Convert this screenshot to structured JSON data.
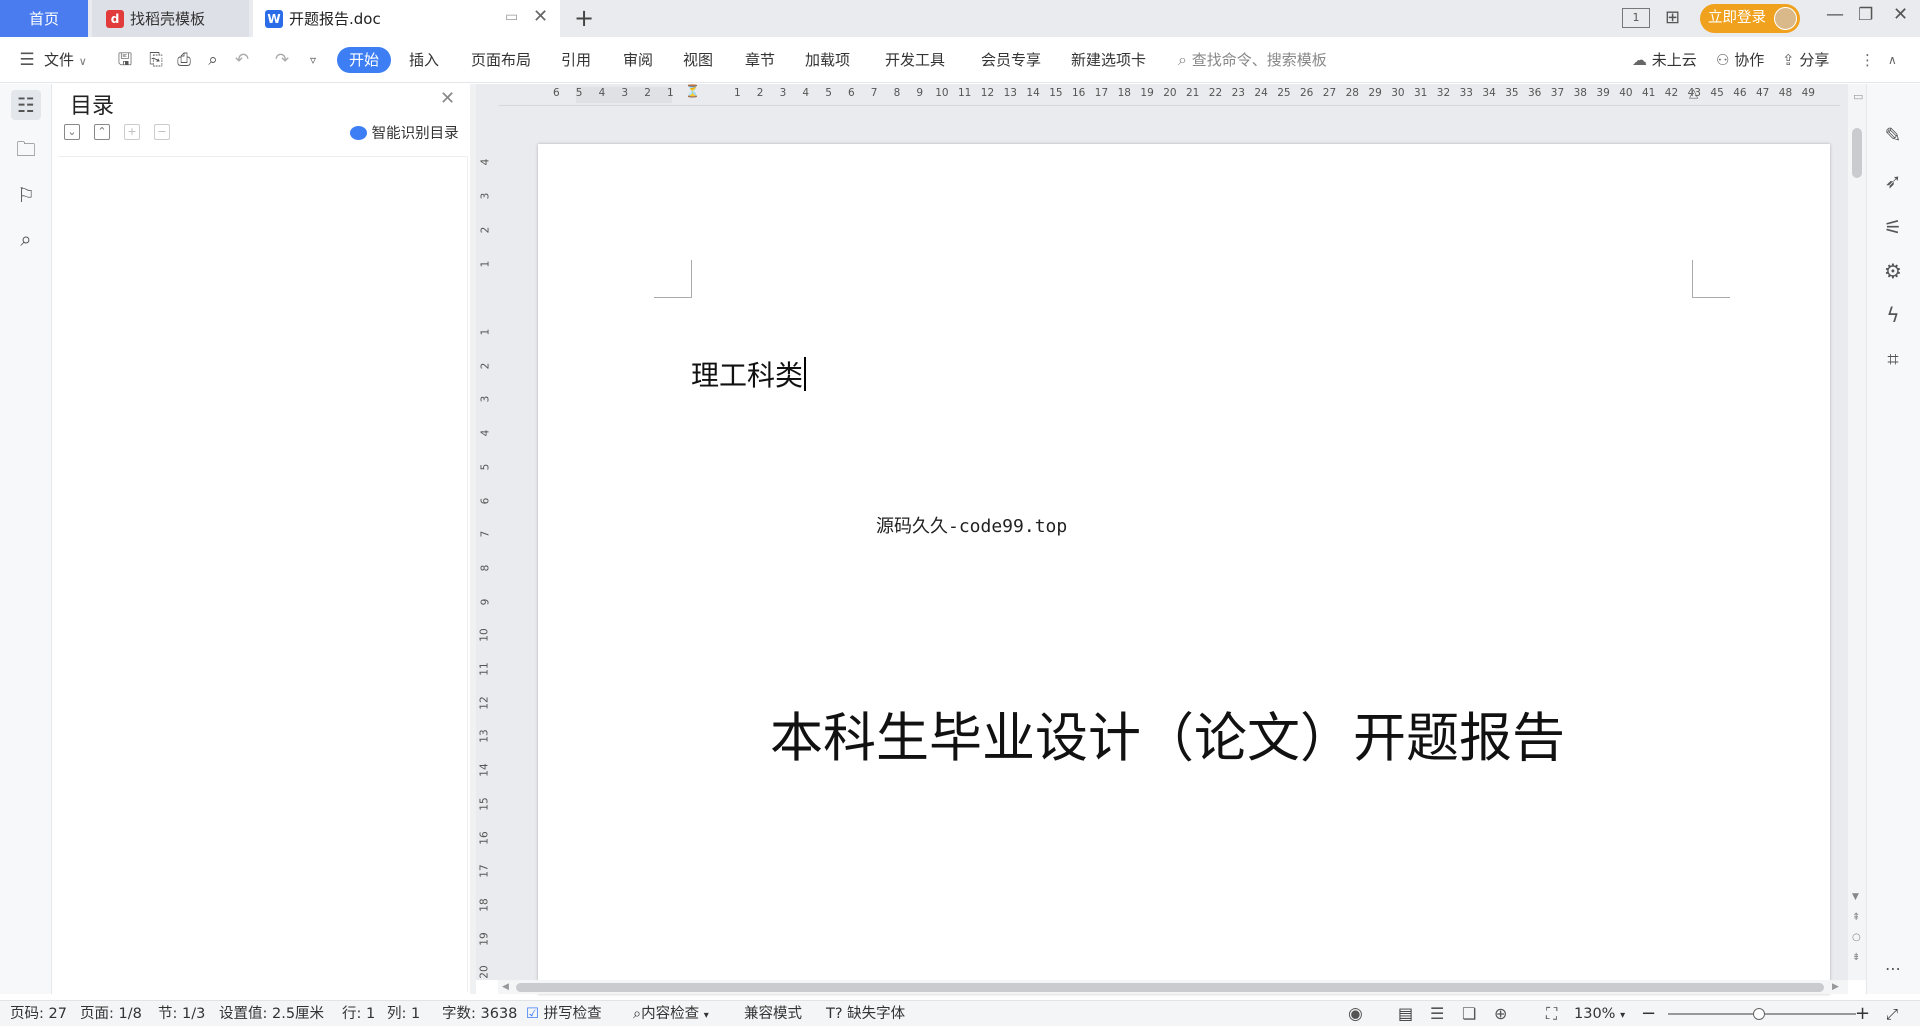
{
  "tabs": {
    "home": "首页",
    "daoke": "找稻壳模板",
    "doc": "开题报告.doc"
  },
  "topright": {
    "login": "立即登录"
  },
  "toolbar": {
    "file": "文件",
    "menus": [
      "开始",
      "插入",
      "页面布局",
      "引用",
      "审阅",
      "视图",
      "章节",
      "加载项",
      "开发工具",
      "会员专享",
      "新建选项卡"
    ],
    "search_placeholder": "查找命令、搜索模板",
    "cloud": "未上云",
    "collab": "协作",
    "share": "分享"
  },
  "toc": {
    "title": "目录",
    "smart": "智能识别目录"
  },
  "ruler": {
    "h_left": [
      "6",
      "5",
      "4",
      "3",
      "2",
      "1"
    ],
    "h_right": [
      "1",
      "2",
      "3",
      "4",
      "5",
      "6",
      "7",
      "8",
      "9",
      "10",
      "11",
      "12",
      "13",
      "14",
      "15",
      "16",
      "17",
      "18",
      "19",
      "20",
      "21",
      "22",
      "23",
      "24",
      "25",
      "26",
      "27",
      "28",
      "29",
      "30",
      "31",
      "32",
      "33",
      "34",
      "35",
      "36",
      "37",
      "38",
      "39",
      "40",
      "41",
      "42",
      "43",
      "45",
      "46",
      "47",
      "48",
      "49"
    ],
    "v_top": [
      "4",
      "3",
      "2",
      "1"
    ],
    "v_bottom": [
      "1",
      "2",
      "3",
      "4",
      "5",
      "6",
      "7",
      "8",
      "9",
      "10",
      "11",
      "12",
      "13",
      "14",
      "15",
      "16",
      "17",
      "18",
      "19",
      "20"
    ]
  },
  "document": {
    "category": "理工科类",
    "watermark": "源码久久-code99.top",
    "title": "本科生毕业设计（论文）开题报告"
  },
  "status": {
    "page_no": "页码: 27",
    "page": "页面: 1/8",
    "section": "节: 1/3",
    "setting": "设置值: 2.5厘米",
    "row": "行: 1",
    "col": "列: 1",
    "words": "字数: 3638",
    "spell": "拼写检查",
    "content_check": "内容检查",
    "compat": "兼容模式",
    "missing_font": "缺失字体",
    "zoom": "130%"
  },
  "colors": {
    "accent": "#3d7ef5",
    "login": "#f0a21e"
  }
}
